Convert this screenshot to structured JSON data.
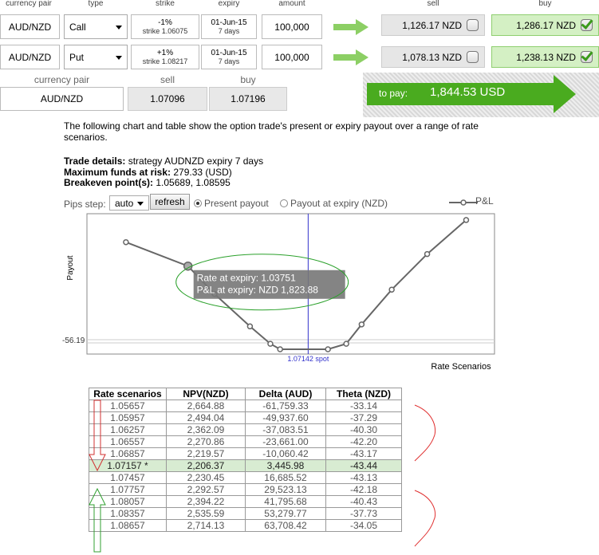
{
  "header": {
    "currency_pair": "currency pair",
    "type": "type",
    "strike": "strike",
    "expiry": "expiry",
    "amount": "amount",
    "sell": "sell",
    "buy": "buy"
  },
  "legs": [
    {
      "pair": "AUD/NZD",
      "type": "Call",
      "strike_pct": "-1%",
      "strike_sub": "strike 1.06075",
      "expiry_date": "01-Jun-15",
      "expiry_days": "7 days",
      "amount": "100,000",
      "sell": "1,126.17 NZD",
      "sell_checked": false,
      "buy": "1,286.17 NZD",
      "buy_checked": true
    },
    {
      "pair": "AUD/NZD",
      "type": "Put",
      "strike_pct": "+1%",
      "strike_sub": "strike 1.08217",
      "expiry_date": "01-Jun-15",
      "expiry_days": "7 days",
      "amount": "100,000",
      "sell": "1,078.13 NZD",
      "sell_checked": false,
      "buy": "1,238.13 NZD",
      "buy_checked": true
    }
  ],
  "spot": {
    "currency_pair_label": "currency pair",
    "sell_label": "sell",
    "buy_label": "buy",
    "pair": "AUD/NZD",
    "sell": "1.07096",
    "buy": "1.07196"
  },
  "pay": {
    "label": "to pay:",
    "amount": "1,844.53 USD",
    "color": "#4aab1f"
  },
  "description": "The following chart and table show the option trade's present or expiry payout over a range of rate scenarios.",
  "trade": {
    "details_label": "Trade details:",
    "details_value": "strategy AUDNZD expiry 7 days",
    "funds_label": "Maximum funds at risk:",
    "funds_value": "279.33 (USD)",
    "breakeven_label": "Breakeven point(s):",
    "breakeven_value": "1.05689, 1.08595"
  },
  "controls": {
    "pips_label": "Pips step:",
    "pips_value": "auto",
    "refresh": "refresh",
    "present_payout": "Present payout",
    "expiry_payout": "Payout at expiry (NZD)",
    "present_selected": true,
    "legend": "P&L"
  },
  "chart_data": {
    "type": "line",
    "ylabel": "Payout",
    "xlabel": "Rate Scenarios",
    "y_tick": "-56.19",
    "spot_label": "1.07142 spot",
    "spot_x": 1.07142,
    "tooltip_line1": "Rate at expiry: 1.03751",
    "tooltip_line2": "P&L at expiry: NZD 1,823.88",
    "highlight_index": 1,
    "series": [
      {
        "name": "P&L",
        "x": [
          1.02,
          1.03751,
          1.045,
          1.055,
          1.06075,
          1.0635,
          1.077,
          1.08217,
          1.0865,
          1.095,
          1.105,
          1.116
        ],
        "y": [
          2430,
          1823.88,
          1120,
          300,
          -140,
          -279.33,
          -279.33,
          -140,
          350,
          1230,
          2130,
          2990
        ]
      }
    ],
    "xlim": [
      1.009,
      1.124
    ],
    "ylim": [
      -400,
      3150
    ],
    "series_color": "#666666",
    "spot_line_color": "#3333cc",
    "ellipse_color": "#2aa02a"
  },
  "table": {
    "headers": [
      "Rate scenarios",
      "NPV(NZD)",
      "Delta (AUD)",
      "Theta (NZD)"
    ],
    "rows": [
      [
        "1.05657",
        "2,664.88",
        "-61,759.33",
        "-33.14"
      ],
      [
        "1.05957",
        "2,494.04",
        "-49,937.60",
        "-37.29"
      ],
      [
        "1.06257",
        "2,362.09",
        "-37,083.51",
        "-40.30"
      ],
      [
        "1.06557",
        "2,270.86",
        "-23,661.00",
        "-42.20"
      ],
      [
        "1.06857",
        "2,219.57",
        "-10,060.42",
        "-43.17"
      ],
      [
        "1.07157 *",
        "2,206.37",
        "3,445.98",
        "-43.44"
      ],
      [
        "1.07457",
        "2,230.45",
        "16,685.52",
        "-43.13"
      ],
      [
        "1.07757",
        "2,292.57",
        "29,523.13",
        "-42.18"
      ],
      [
        "1.08057",
        "2,394.22",
        "41,795.68",
        "-40.43"
      ],
      [
        "1.08357",
        "2,535.59",
        "53,279.77",
        "-37.73"
      ],
      [
        "1.08657",
        "2,714.13",
        "63,708.42",
        "-34.05"
      ]
    ],
    "spot_row": 5
  }
}
